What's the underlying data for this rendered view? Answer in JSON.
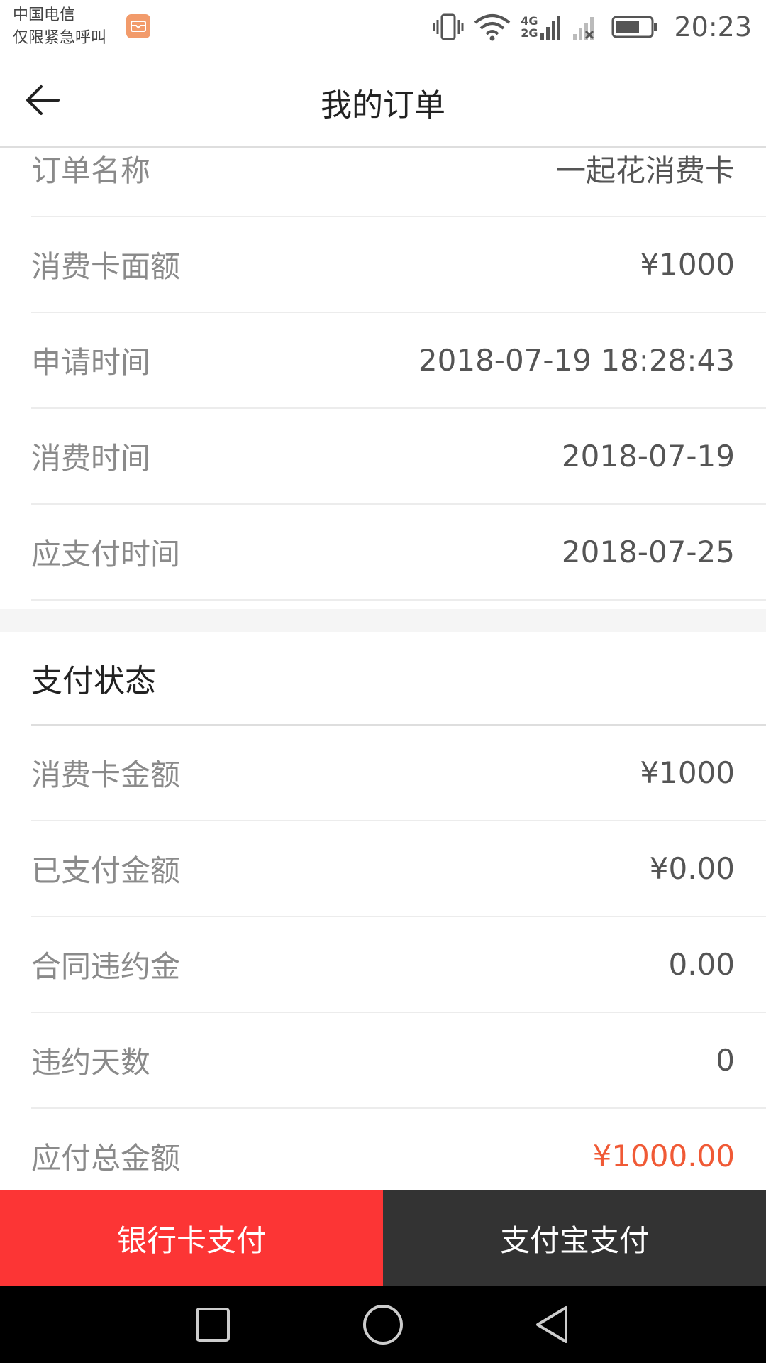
{
  "status_bar": {
    "carrier_line1": "中国电信",
    "carrier_line2": "仅限紧急呼叫",
    "network_top": "4G",
    "network_bottom": "2G",
    "time": "20:23"
  },
  "header": {
    "title": "我的订单"
  },
  "order_info": [
    {
      "label": "订单名称",
      "value": "一起花消费卡"
    },
    {
      "label": "消费卡面额",
      "value": "¥1000"
    },
    {
      "label": "申请时间",
      "value": "2018-07-19 18:28:43"
    },
    {
      "label": "消费时间",
      "value": "2018-07-19"
    },
    {
      "label": "应支付时间",
      "value": "2018-07-25"
    }
  ],
  "payment_status": {
    "title": "支付状态",
    "rows": [
      {
        "label": "消费卡金额",
        "value": "¥1000"
      },
      {
        "label": "已支付金额",
        "value": "¥0.00"
      },
      {
        "label": "合同违约金",
        "value": "0.00"
      },
      {
        "label": "违约天数",
        "value": "0"
      },
      {
        "label": "应付总金额",
        "value": "¥1000.00"
      }
    ]
  },
  "actions": {
    "bank_card_pay": "银行卡支付",
    "alipay_pay": "支付宝支付"
  },
  "colors": {
    "bank_button": "#fc3535",
    "alipay_button": "#333333",
    "total_amount": "#f05a36"
  }
}
